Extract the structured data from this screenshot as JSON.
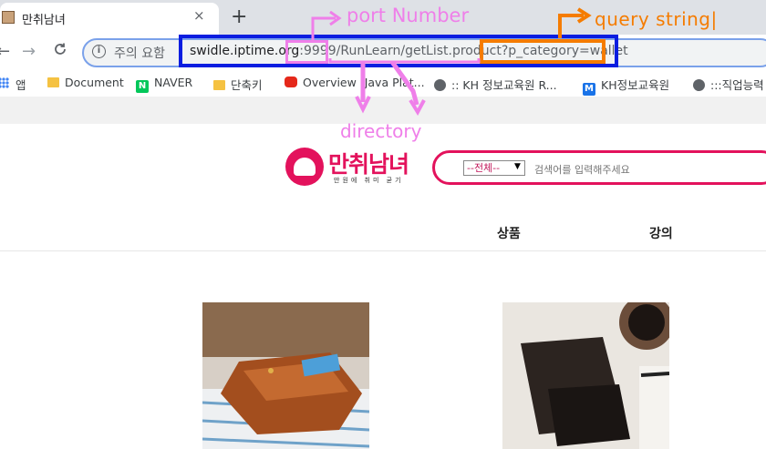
{
  "browser": {
    "tab_title": "만취남녀",
    "tab_close": "×",
    "new_tab": "+",
    "back": "←",
    "forward": "→",
    "reload": "C",
    "security_label": "주의 요함",
    "url": {
      "host": "swidle.iptime.org",
      "port": ":9999",
      "path": "/RunLearn/getList.product",
      "query": "?p_category=wallet"
    }
  },
  "bookmarks": [
    {
      "label": "앱",
      "icon": "apps-icon"
    },
    {
      "label": "Document",
      "icon": "folder-icon"
    },
    {
      "label": "NAVER",
      "icon": "naver-icon"
    },
    {
      "label": "단축키",
      "icon": "folder-icon"
    },
    {
      "label": "Overview (Java Plat...",
      "icon": "oracle-icon"
    },
    {
      "label": ":: KH 정보교육원 R...",
      "icon": "globe-icon"
    },
    {
      "label": "KH정보교육원",
      "icon": "m-icon"
    },
    {
      "label": ":::직업능력",
      "icon": "globe-icon"
    }
  ],
  "site": {
    "logo_text": "만취남녀",
    "logo_subtitle": "만원에 취미 굳기",
    "search": {
      "select_value": "--전체--",
      "placeholder": "검색어를 입력해주세요"
    },
    "nav": [
      "상품",
      "강의"
    ]
  },
  "annotations": {
    "port": "port Number",
    "query": "query string|",
    "directory": "directory"
  },
  "colors": {
    "brand": "#e3125c",
    "annotation_blue": "#0a1de0",
    "annotation_orange": "#f57c00",
    "annotation_pink": "#ef7fe9"
  }
}
